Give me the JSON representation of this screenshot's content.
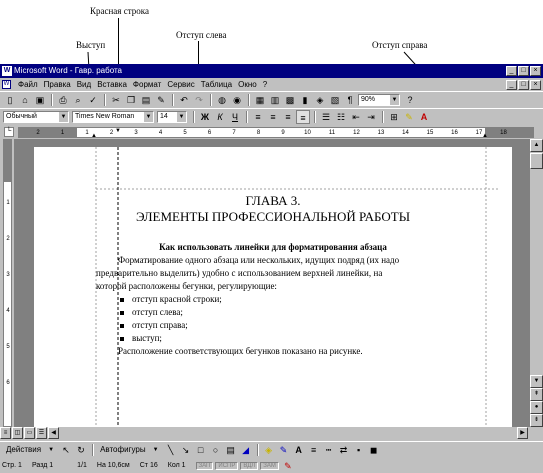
{
  "callouts": {
    "first_line": "Красная строка",
    "hanging": "Выступ",
    "left_indent": "Отступ слева",
    "right_indent": "Отступ справа"
  },
  "window": {
    "title": "Microsoft Word - Гавр. работа",
    "app_icon": "W",
    "controls": [
      "_",
      "□",
      "×"
    ]
  },
  "menu": {
    "items": [
      "Файл",
      "Правка",
      "Вид",
      "Вставка",
      "Формат",
      "Сервис",
      "Таблица",
      "Окно",
      "?"
    ]
  },
  "standard_toolbar": {
    "icons": [
      "new-doc-icon",
      "open-icon",
      "save-icon",
      "print-icon",
      "preview-icon",
      "spell-icon",
      "cut-icon",
      "copy-icon",
      "paste-icon",
      "format-painter-icon",
      "undo-icon",
      "redo-icon",
      "hyperlink-icon",
      "web-icon",
      "table-icon",
      "insert-table-icon",
      "excel-icon",
      "columns-icon",
      "drawing-icon",
      "docmap-icon",
      "pilcrow-icon",
      "help-icon"
    ],
    "zoom": "90%"
  },
  "format_toolbar": {
    "style": "Обычный",
    "font": "Times New Roman",
    "size": "14",
    "bold": "Ж",
    "italic": "К",
    "underline": "Ч"
  },
  "ruler": {
    "numbers": [
      "2",
      "1",
      "1",
      "2",
      "3",
      "4",
      "5",
      "6",
      "7",
      "8",
      "9",
      "10",
      "11",
      "12",
      "13",
      "14",
      "15",
      "16",
      "17",
      "18"
    ]
  },
  "document": {
    "title_line1": "ГЛАВА 3.",
    "title_line2": "ЭЛЕМЕНТЫ ПРОФЕССИОНАЛЬНОЙ РАБОТЫ",
    "heading": "Как использовать линейки для форматирования абзаца",
    "para_line1": "Форматирование одного абзаца или нескольких, идущих подряд (их надо",
    "para_line2": "предварительно выделить) удобно с использованием верхней линейки, на",
    "para_line3": "которой расположены бегунки, регулирующие:",
    "bullets": [
      "отступ красной строки;",
      "отступ слева;",
      "отступ справа;",
      "выступ;"
    ],
    "closing": "Расположение соответствующих бегунков показано на рисунке."
  },
  "drawing_toolbar": {
    "actions": "Действия",
    "autoshapes": "Автофигуры"
  },
  "status": {
    "page": "Стр. 1",
    "section": "Разд 1",
    "pages": "1/1",
    "at": "На 10,6см",
    "line": "Ст 16",
    "col": "Кол 1",
    "modes": [
      "ЗАП",
      "ИСПР",
      "ВДЛ",
      "ЗАМ"
    ]
  }
}
